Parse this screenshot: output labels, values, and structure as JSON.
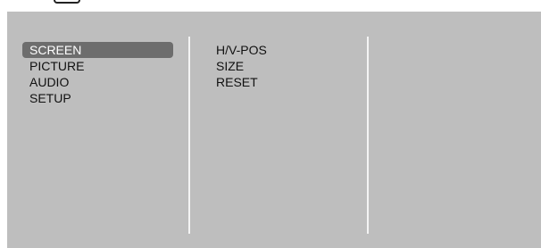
{
  "colors": {
    "panel_bg": "#bebebe",
    "divider": "#f4f4f4",
    "selected_bg": "#6d6d6d",
    "selected_text": "#ffffff",
    "text": "#111111"
  },
  "main_menu": {
    "selected_index": 0,
    "items": [
      {
        "label": "SCREEN"
      },
      {
        "label": "PICTURE"
      },
      {
        "label": "AUDIO"
      },
      {
        "label": "SETUP"
      }
    ]
  },
  "sub_menu": {
    "items": [
      {
        "label": "H/V-POS"
      },
      {
        "label": "SIZE"
      },
      {
        "label": "RESET"
      }
    ]
  }
}
